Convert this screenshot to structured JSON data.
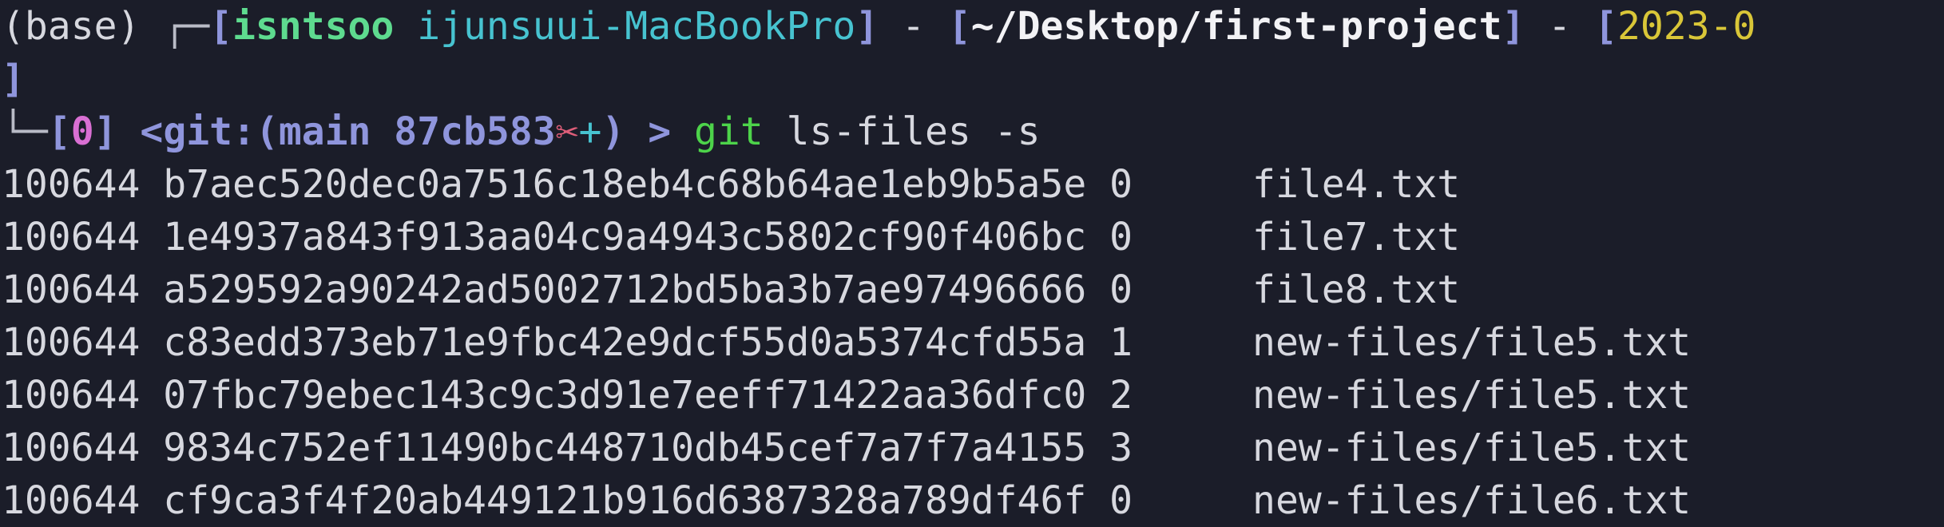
{
  "prompt": {
    "env": "(base)",
    "corner": "┌─",
    "open_bracket": "[",
    "close_bracket": "]",
    "user": "isntsoo",
    "host": "ijunsuui-MacBookPro",
    "sep": " - ",
    "path": "~/Desktop/first-project",
    "date": "2023-0",
    "wrap_close": "]",
    "corner2": "└─",
    "index": "0",
    "git_open": "<git:(",
    "branch": "main 87cb583",
    "dirty_mark": "✂",
    "staged_mark": "+",
    "git_close": ")",
    "arrow": ">",
    "command": "git",
    "args": "ls-files -s"
  },
  "rows": [
    {
      "mode": "100644",
      "hash": "b7aec520dec0a7516c18eb4c68b64ae1eb9b5a5e",
      "stage": "0",
      "file": "file4.txt"
    },
    {
      "mode": "100644",
      "hash": "1e4937a843f913aa04c9a4943c5802cf90f406bc",
      "stage": "0",
      "file": "file7.txt"
    },
    {
      "mode": "100644",
      "hash": "a529592a90242ad5002712bd5ba3b7ae97496666",
      "stage": "0",
      "file": "file8.txt"
    },
    {
      "mode": "100644",
      "hash": "c83edd373eb71e9fbc42e9dcf55d0a5374cfd55a",
      "stage": "1",
      "file": "new-files/file5.txt"
    },
    {
      "mode": "100644",
      "hash": "07fbc79ebec143c9c3d91e7eeff71422aa36dfc0",
      "stage": "2",
      "file": "new-files/file5.txt"
    },
    {
      "mode": "100644",
      "hash": "9834c752ef11490bc448710db45cef7a7f7a4155",
      "stage": "3",
      "file": "new-files/file5.txt"
    },
    {
      "mode": "100644",
      "hash": "cf9ca3f4f20ab449121b916d6387328a789df46f",
      "stage": "0",
      "file": "new-files/file6.txt"
    }
  ],
  "colors": {
    "background": "#1b1d29",
    "text": "#d7d8df",
    "bracket": "#8f95dc",
    "user": "#5edb8f",
    "host": "#47c3d0",
    "date": "#d9c638",
    "index": "#d96fd3",
    "command": "#4dd34a"
  }
}
